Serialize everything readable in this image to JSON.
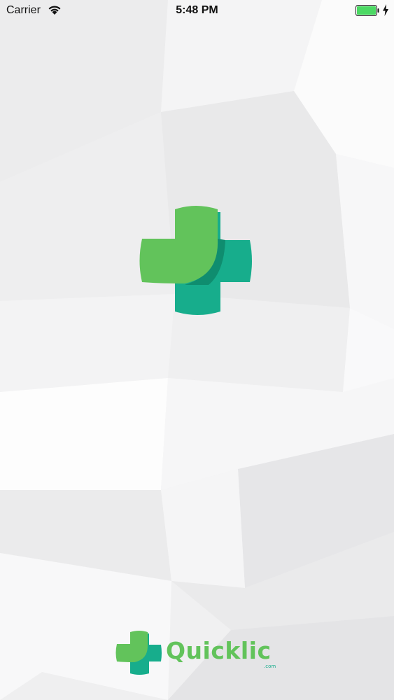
{
  "status_bar": {
    "carrier": "Carrier",
    "time": "5:48 PM",
    "wifi_icon": "wifi-icon",
    "battery_icon": "battery-icon",
    "charging_icon": "bolt-icon"
  },
  "splash": {
    "logo_icon": "medical-cross-icon",
    "brand_name": "Quicklic",
    "brand_suffix": ".com"
  },
  "colors": {
    "primary_green": "#62c35b",
    "secondary_teal": "#17ad8c",
    "background": "#f1f1f2",
    "battery_green": "#4cd964"
  }
}
